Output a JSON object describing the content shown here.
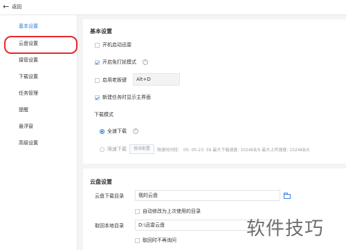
{
  "topbar": {
    "back_label": "返回"
  },
  "sidebar": {
    "items": [
      {
        "label": "基本设置",
        "active": true
      },
      {
        "label": "云盘设置",
        "active": false
      },
      {
        "label": "接管设置",
        "active": false
      },
      {
        "label": "下载设置",
        "active": false
      },
      {
        "label": "任务管理",
        "active": false
      },
      {
        "label": "提醒",
        "active": false
      },
      {
        "label": "悬浮窗",
        "active": false
      },
      {
        "label": "高级设置",
        "active": false
      }
    ]
  },
  "basic": {
    "title": "基本设置",
    "autostart": {
      "label": "开机启动迅雷",
      "checked": false
    },
    "dnd": {
      "label": "开启免打扰模式",
      "checked": true
    },
    "bosskey": {
      "label": "启用老板键",
      "checked": false,
      "value": "Alt+D"
    },
    "show_main": {
      "label": "新建任务时显示主界面",
      "checked": true
    },
    "download_mode": {
      "title": "下载模式",
      "full_speed": {
        "label": "全速下载",
        "selected": true
      },
      "limited": {
        "label": "限速下载",
        "selected": false,
        "button": "修改配置",
        "info": "限速时间段： 00: 00-23: 59  最大下载速度: 1024KB/S   最大上传速度: 1024KB/S"
      }
    }
  },
  "cloud": {
    "title": "云盘设置",
    "download_dir": {
      "label": "云盘下载目录",
      "value": "我的云盘"
    },
    "auto_change": {
      "label": "自动修改为上次使用的目录",
      "checked": false
    },
    "local_dir": {
      "label": "取回本地目录",
      "value": "D:\\迅雷云盘"
    },
    "no_ask": {
      "label": "取回时不再询问",
      "checked": false
    }
  },
  "watermark": "软件技巧",
  "colors": {
    "accent": "#2f7de1",
    "highlight": "#e4252a"
  }
}
